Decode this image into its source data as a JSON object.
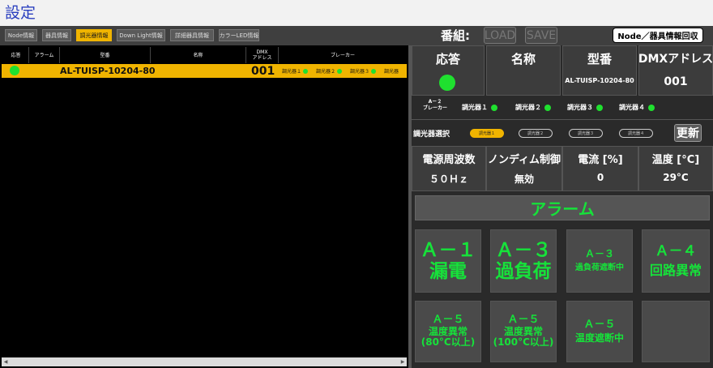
{
  "window": {
    "title": "設定"
  },
  "tabs": [
    {
      "label": "Node情報"
    },
    {
      "label": "器具情報"
    },
    {
      "label": "調光器情報",
      "active": true
    },
    {
      "label": "Down Light情報"
    },
    {
      "label": "詳細器具情報"
    },
    {
      "label": "カラーLED情報"
    }
  ],
  "program": {
    "label": "番組:",
    "load": "LOAD",
    "save": "SAVE",
    "node_button": "Node／器具情報回収"
  },
  "list": {
    "headers": [
      "応答",
      "アラーム",
      "型番",
      "名称",
      "DMX\nアドレス",
      "ブレーカー"
    ],
    "rows": [
      {
        "model": "AL-TUISP-10204-80",
        "name": "",
        "dmx": "001",
        "breakers": [
          "調光器１",
          "調光器２",
          "調光器３",
          "調光器"
        ]
      }
    ]
  },
  "detail": {
    "headers": {
      "response": "応答",
      "name": "名称",
      "model": "型番",
      "dmx": "DMXアドレス"
    },
    "model_value": "AL-TUISP-10204-80",
    "dmx_value": "001",
    "breaker_label": "A－２\nブレーカー",
    "breakers": [
      "調光器１",
      "調光器２",
      "調光器３",
      "調光器４"
    ],
    "selector_label": "調光器選択",
    "selector_options": [
      "調光器１",
      "調光器２",
      "調光器３",
      "調光器４"
    ],
    "update_button": "更新",
    "stats": [
      {
        "label": "電源周波数",
        "value": "５０Ｈｚ"
      },
      {
        "label": "ノンディム制御",
        "value": "無効"
      },
      {
        "label": "電流 [%]",
        "value": "0"
      },
      {
        "label": "温度 [°C]",
        "value": "29°C"
      }
    ]
  },
  "alarm": {
    "title": "アラーム",
    "items": [
      {
        "code": "Ａ－１",
        "text": "漏電"
      },
      {
        "code": "Ａ－３",
        "text": "過負荷"
      },
      {
        "code": "Ａ－３",
        "text": "過負荷遮断中"
      },
      {
        "code": "Ａ－４",
        "text": "回路異常"
      },
      {
        "code": "Ａ－５",
        "text": "温度異常\n(80°C以上)"
      },
      {
        "code": "Ａ－５",
        "text": "温度異常\n(100°C以上)"
      },
      {
        "code": "Ａ－５",
        "text": "温度遮断中"
      },
      {
        "code": "",
        "text": ""
      }
    ]
  },
  "colors": {
    "accent": "#f0b400",
    "ok": "#1fe02f",
    "alarm_text": "#16e23a",
    "title": "#2a3fbf"
  }
}
